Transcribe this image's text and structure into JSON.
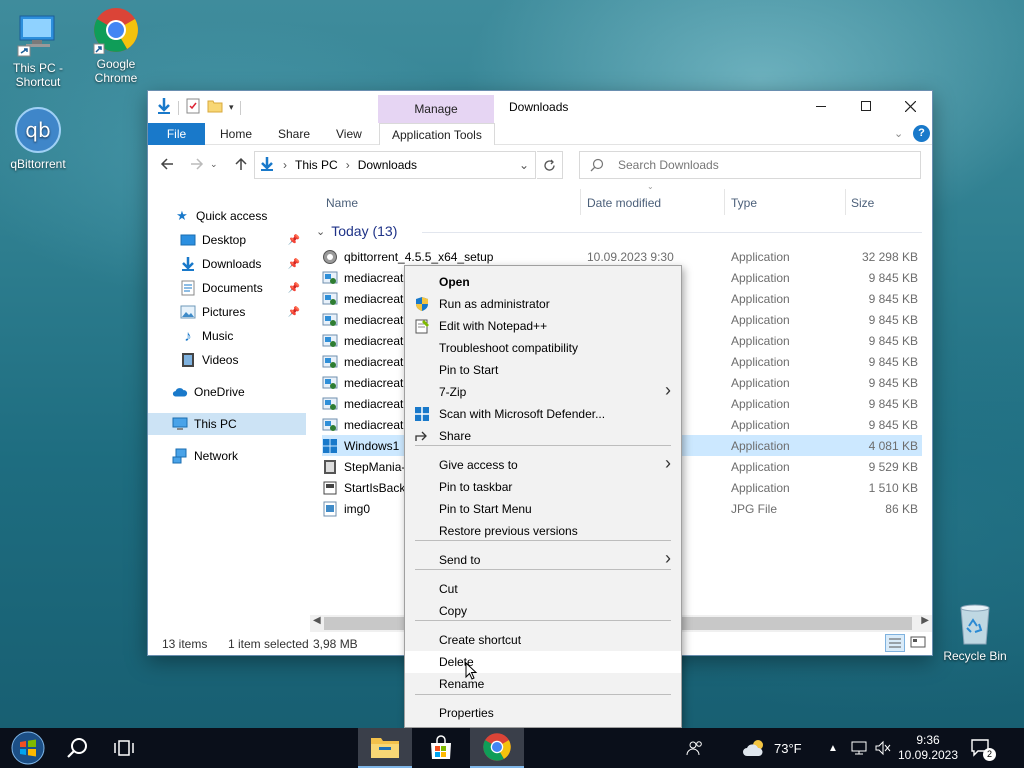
{
  "desktop": {
    "icons": [
      {
        "label_line1": "This PC -",
        "label_line2": "Shortcut"
      },
      {
        "label_line1": "Google",
        "label_line2": "Chrome"
      },
      {
        "label_line1": "qBittorrent",
        "label_line2": ""
      },
      {
        "label_line1": "Recycle Bin",
        "label_line2": ""
      }
    ]
  },
  "window": {
    "title": "Downloads",
    "manage_tab": "Manage",
    "ribbon_tabs": [
      "File",
      "Home",
      "Share",
      "View",
      "Application Tools"
    ],
    "breadcrumb": [
      "This PC",
      "Downloads"
    ],
    "search_placeholder": "Search Downloads",
    "columns": [
      "Name",
      "Date modified",
      "Type",
      "Size"
    ],
    "group_label": "Today (13)",
    "nav": [
      {
        "label": "Quick access"
      },
      {
        "label": "Desktop"
      },
      {
        "label": "Downloads"
      },
      {
        "label": "Documents"
      },
      {
        "label": "Pictures"
      },
      {
        "label": "Music"
      },
      {
        "label": "Videos"
      },
      {
        "label": "OneDrive"
      },
      {
        "label": "This PC"
      },
      {
        "label": "Network"
      }
    ],
    "files": [
      {
        "name": "qbittorrent_4.5.5_x64_setup",
        "date": "10.09.2023 9:30",
        "type": "Application",
        "size": "32 298 KB"
      },
      {
        "name": "mediacreat",
        "date": "",
        "type": "Application",
        "size": "9 845 KB"
      },
      {
        "name": "mediacreat",
        "date": "",
        "type": "Application",
        "size": "9 845 KB"
      },
      {
        "name": "mediacreat",
        "date": "",
        "type": "Application",
        "size": "9 845 KB"
      },
      {
        "name": "mediacreat",
        "date": "",
        "type": "Application",
        "size": "9 845 KB"
      },
      {
        "name": "mediacreat",
        "date": "",
        "type": "Application",
        "size": "9 845 KB"
      },
      {
        "name": "mediacreat",
        "date": "",
        "type": "Application",
        "size": "9 845 KB"
      },
      {
        "name": "mediacreat",
        "date": "",
        "type": "Application",
        "size": "9 845 KB"
      },
      {
        "name": "mediacreat",
        "date": "",
        "type": "Application",
        "size": "9 845 KB"
      },
      {
        "name": "Windows1",
        "date": "",
        "type": "Application",
        "size": "4 081 KB"
      },
      {
        "name": "StepMania-",
        "date": "",
        "type": "Application",
        "size": "9 529 KB"
      },
      {
        "name": "StartIsBack",
        "date": "",
        "type": "Application",
        "size": "1 510 KB"
      },
      {
        "name": "img0",
        "date": "",
        "type": "JPG File",
        "size": "86 KB"
      }
    ],
    "status": {
      "items": "13 items",
      "selected": "1 item selected",
      "size": "3,98 MB"
    }
  },
  "context_menu": {
    "items": [
      "Open",
      "Run as administrator",
      "Edit with Notepad++",
      "Troubleshoot compatibility",
      "Pin to Start",
      "7-Zip",
      "Scan with Microsoft Defender...",
      "Share",
      "Give access to",
      "Pin to taskbar",
      "Pin to Start Menu",
      "Restore previous versions",
      "Send to",
      "Cut",
      "Copy",
      "Create shortcut",
      "Delete",
      "Rename",
      "Properties"
    ]
  },
  "taskbar": {
    "weather": "73°F",
    "time": "9:36",
    "date": "10.09.2023",
    "notification_count": "2"
  },
  "colors": {
    "accent": "#1979ca",
    "selection": "#cce8ff",
    "manage_tab": "#e6d5f3",
    "taskbar": "#0a0f1a"
  }
}
